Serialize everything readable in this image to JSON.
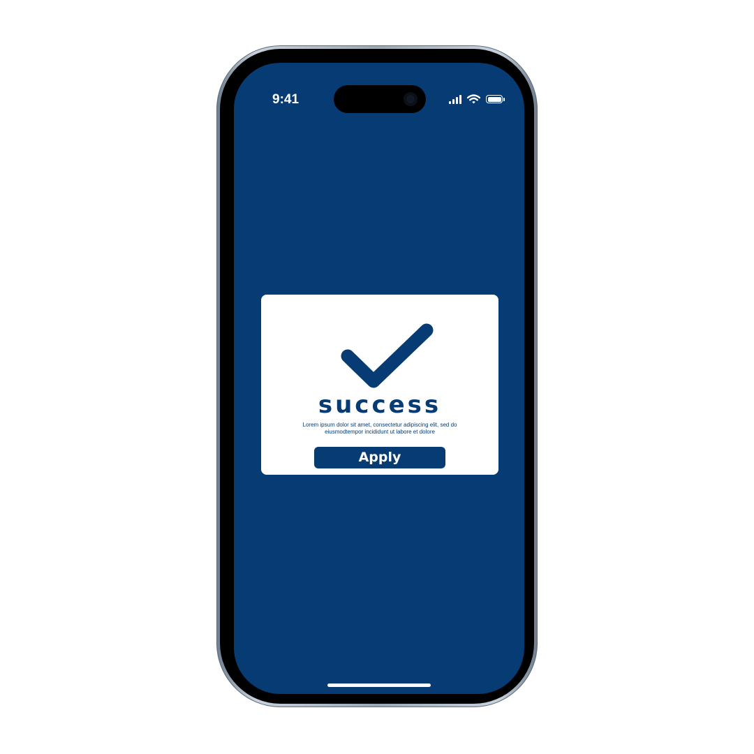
{
  "status_bar": {
    "time": "9:41",
    "icons": [
      "cellular-signal-icon",
      "wifi-icon",
      "battery-icon"
    ]
  },
  "dialog": {
    "icon": "checkmark-icon",
    "title": "success",
    "description": "Lorem ipsum dolor sit amet, consectetur adipiscing elit, sed do eiusmodtempor incididunt ut labore et dolore",
    "button_label": "Apply"
  },
  "colors": {
    "background": "#063b73",
    "card": "#ffffff",
    "accent": "#063b73",
    "button_text": "#ffffff"
  }
}
